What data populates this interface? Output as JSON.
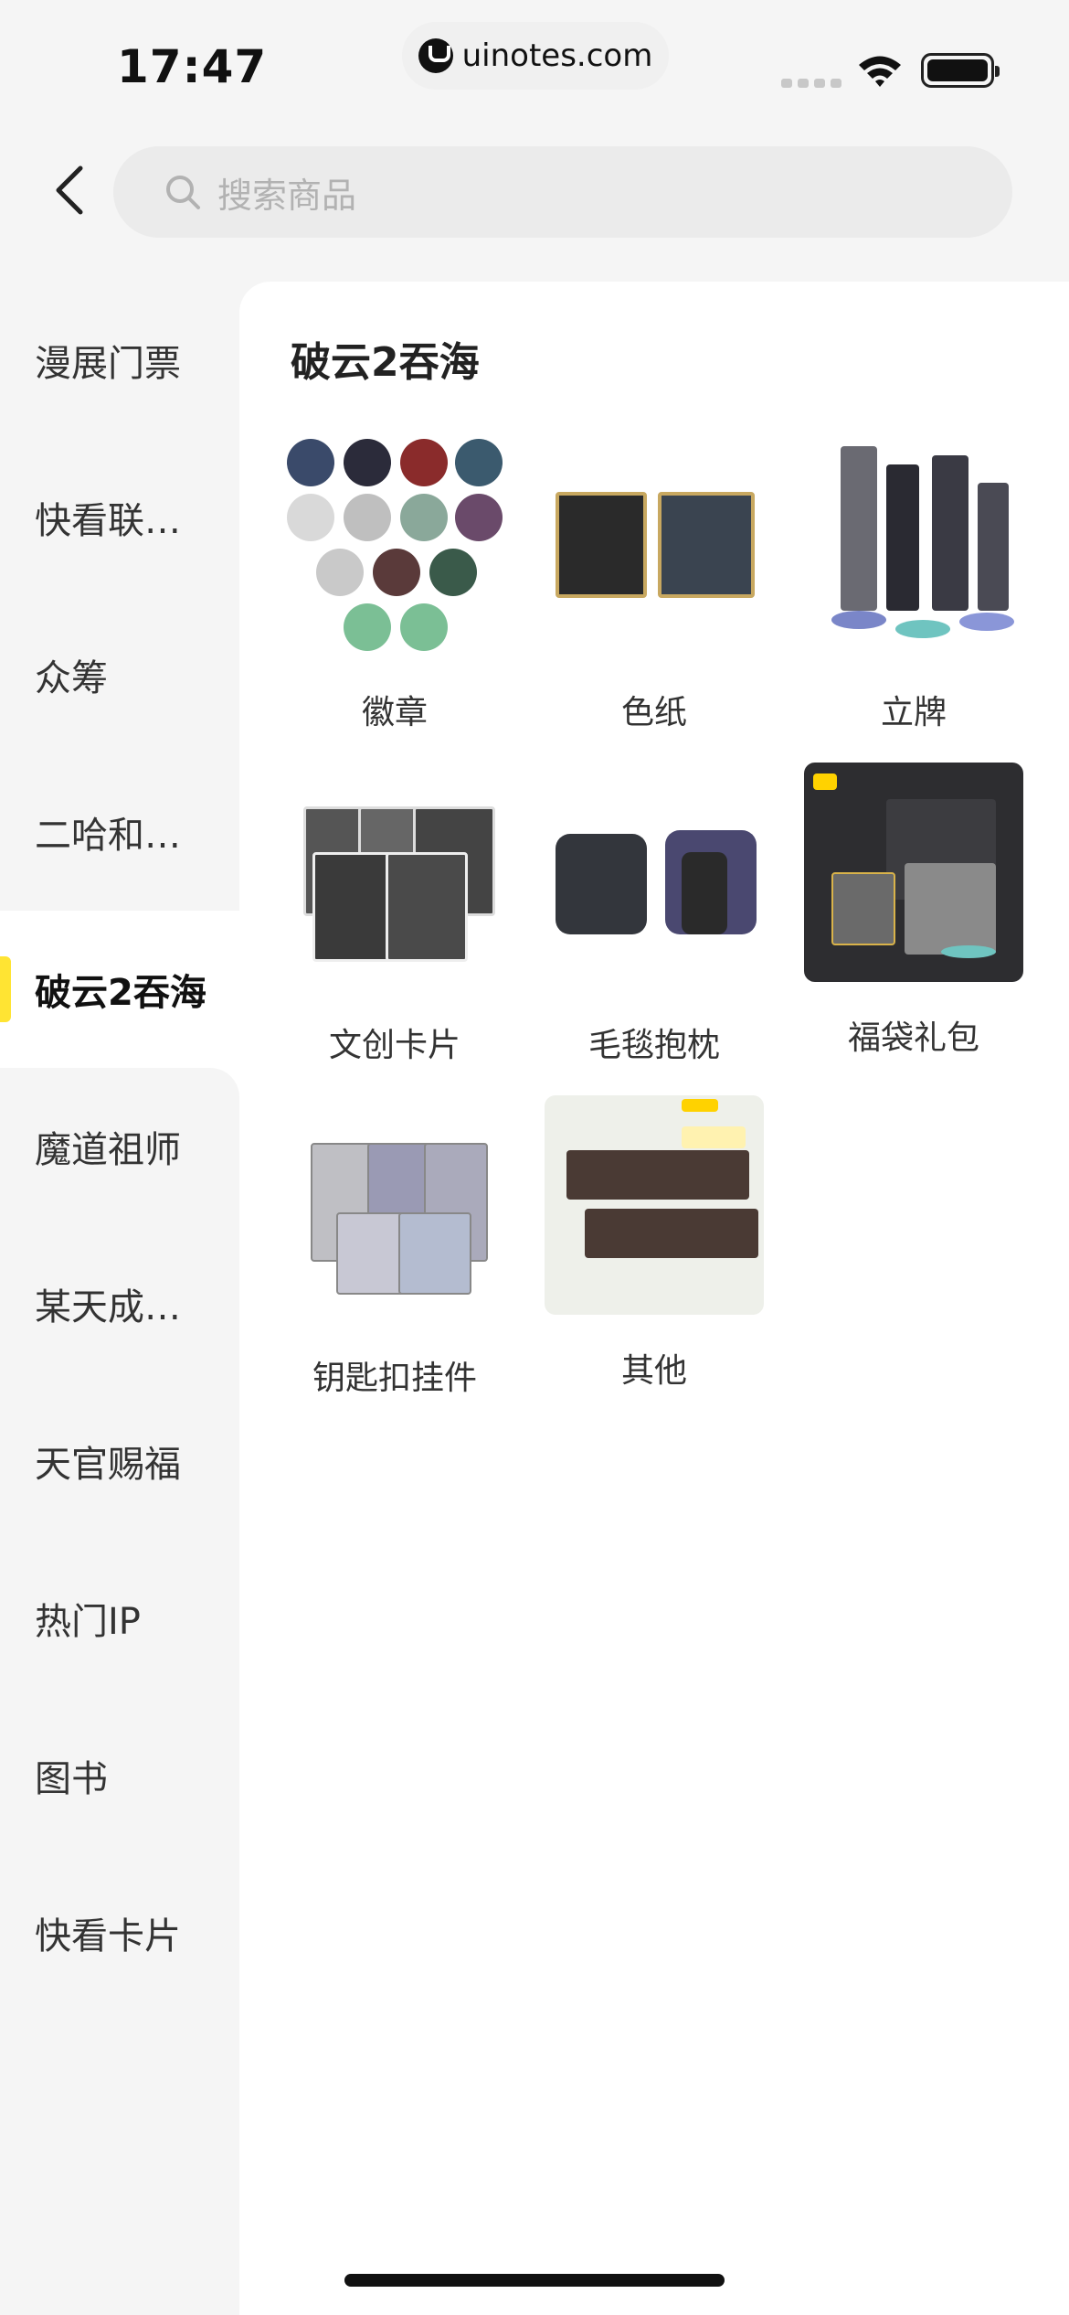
{
  "status_bar": {
    "time": "17:47",
    "url": "uinotes.com"
  },
  "search": {
    "placeholder": "搜索商品"
  },
  "sidebar": {
    "items": [
      {
        "label": "漫展门票"
      },
      {
        "label": "快看联…"
      },
      {
        "label": "众筹"
      },
      {
        "label": "二哈和…"
      },
      {
        "label": "破云2吞海",
        "active": true
      },
      {
        "label": "魔道祖师"
      },
      {
        "label": "某天成…"
      },
      {
        "label": "天官赐福"
      },
      {
        "label": "热门IP"
      },
      {
        "label": "图书"
      },
      {
        "label": "快看卡片"
      }
    ]
  },
  "content": {
    "title": "破云2吞海",
    "items": [
      {
        "label": "徽章",
        "icon": "badge-set-icon"
      },
      {
        "label": "色纸",
        "icon": "shikishi-icon"
      },
      {
        "label": "立牌",
        "icon": "acrylic-stand-icon"
      },
      {
        "label": "文创卡片",
        "icon": "card-set-icon"
      },
      {
        "label": "毛毯抱枕",
        "icon": "pillow-icon"
      },
      {
        "label": "福袋礼包",
        "icon": "lucky-bag-icon"
      },
      {
        "label": "钥匙扣挂件",
        "icon": "keychain-icon"
      },
      {
        "label": "其他",
        "icon": "misc-goods-icon"
      }
    ]
  },
  "colors": {
    "accent": "#ffe433",
    "background": "#f5f5f5",
    "panel": "#ffffff"
  }
}
